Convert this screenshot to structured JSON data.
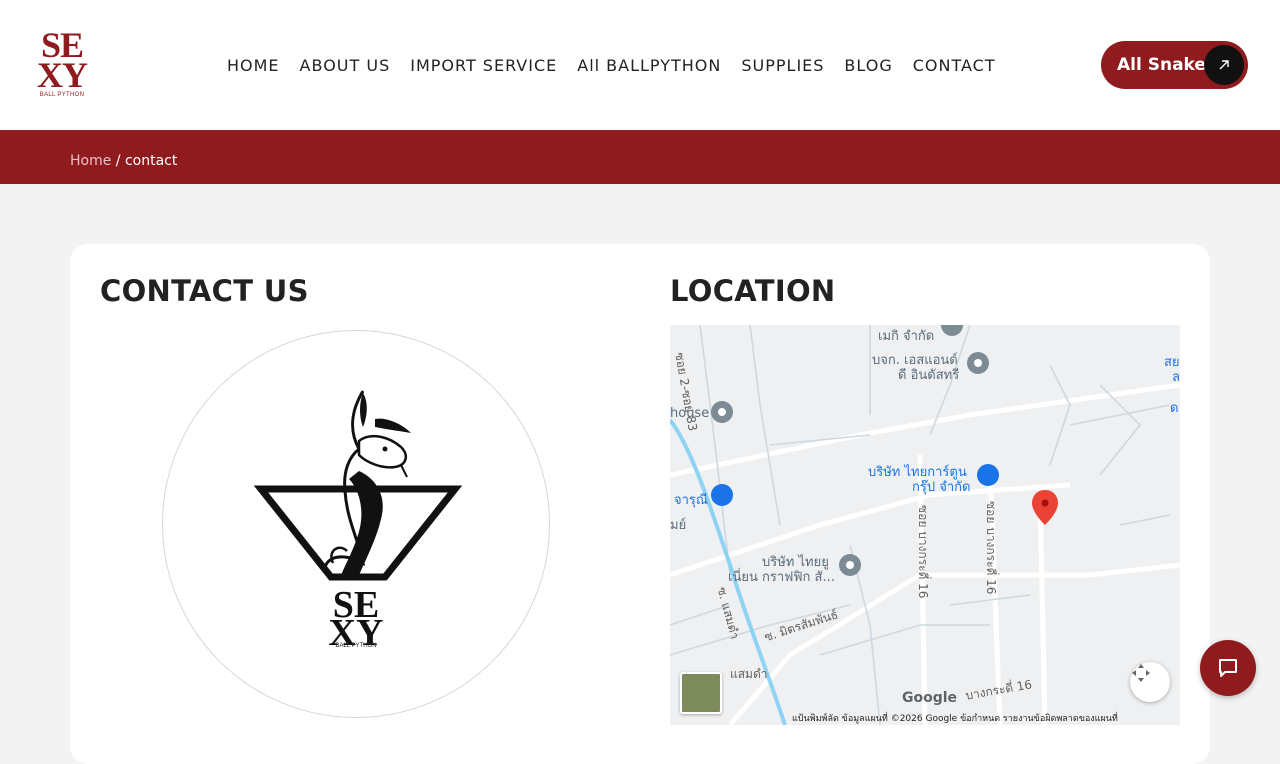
{
  "header": {
    "logo": {
      "line1": "SE",
      "line2": "XY",
      "tagline": "BALL PYTHON"
    },
    "nav": [
      {
        "label": "HOME"
      },
      {
        "label": "ABOUT US"
      },
      {
        "label": "IMPORT SERVICE"
      },
      {
        "label": "All BALLPYTHON"
      },
      {
        "label": "SUPPLIES"
      },
      {
        "label": "BLOG"
      },
      {
        "label": "CONTACT"
      }
    ],
    "cta": {
      "label": "All Snake",
      "icon": "arrow-up-right-icon"
    }
  },
  "breadcrumb": {
    "home": "Home",
    "separator": " / ",
    "current": "contact"
  },
  "contact": {
    "title": "CONTACT US",
    "logo": {
      "line1": "SE",
      "line2": "XY",
      "tagline": "BALL PYTHON"
    }
  },
  "location": {
    "title": "LOCATION",
    "map_labels": {
      "house": "house",
      "company1": "เมกิ จำกัด",
      "company2_a": "บจก. เอสแอนด์",
      "company2_b": "ดี อินดัสทรี",
      "company3_a": "บริษัท ไทยการ์ตูน",
      "company3_b": "กรุ๊ป จำกัด",
      "company4_a": "บริษัท ไทยยู",
      "company4_b": "เนี่ยน กราฟฟิก สั...",
      "store": "จารุณี",
      "road1": "ซอย 2-ซอย 83",
      "road2": "ซอย บางกระดี่ 16",
      "road3": "ซอย บางกระดี่ 16",
      "road4": "ซ. มิตรสัมพันธ์",
      "road5": "ซ. แสมดำ",
      "road6": "แสมดำ",
      "road7": "บางกระดี่ 16",
      "edge1": "สย",
      "edge2": "ล",
      "edge3": "ด",
      "edge4": "มย์"
    },
    "google": "Google",
    "footer": "แป้นพิมพ์ลัด   ข้อมูลแผนที่ ©2026 Google   ข้อกำหนด   รายงานข้อผิดพลาดของแผนที่"
  },
  "chat": {
    "icon": "chat-icon"
  },
  "colors": {
    "brand": "#8f1b1f",
    "background": "#f3f3f3",
    "card": "#ffffff"
  }
}
